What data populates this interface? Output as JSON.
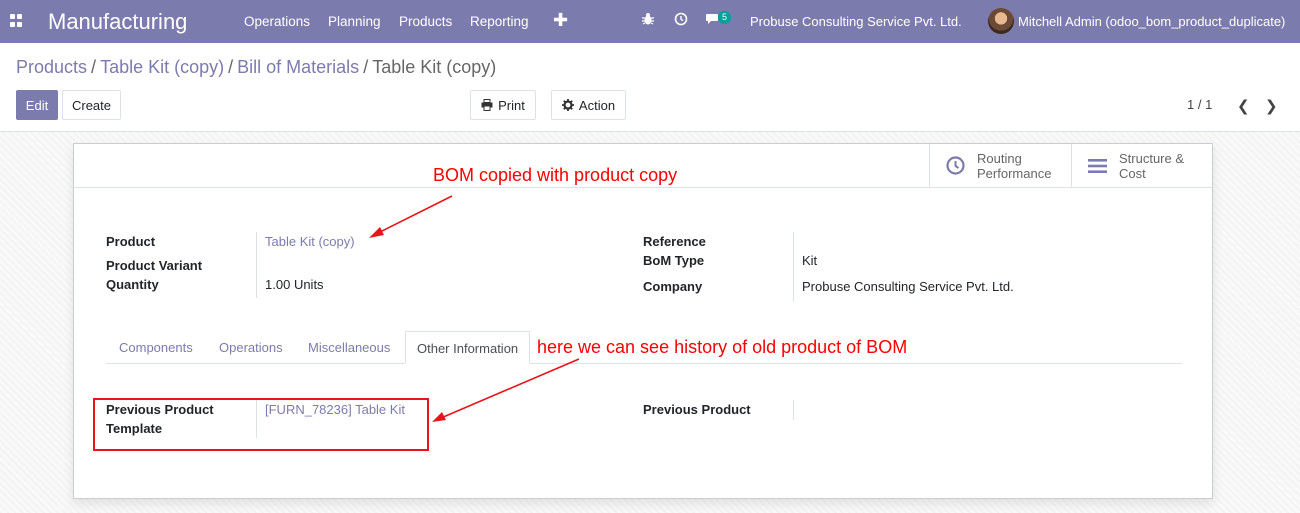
{
  "nav": {
    "brand": "Manufacturing",
    "menu": [
      "Operations",
      "Planning",
      "Products",
      "Reporting"
    ],
    "chat_count": "5",
    "company": "Probuse Consulting Service Pvt. Ltd.",
    "user": "Mitchell Admin (odoo_bom_product_duplicate)"
  },
  "breadcrumb": [
    "Products",
    "Table Kit (copy)",
    "Bill of Materials",
    "Table Kit (copy)"
  ],
  "buttons": {
    "edit": "Edit",
    "create": "Create",
    "print": "Print",
    "action": "Action"
  },
  "pager": "1 / 1",
  "smart_buttons": {
    "routing": [
      "Routing",
      "Performance"
    ],
    "structure": [
      "Structure &",
      "Cost"
    ]
  },
  "fields": {
    "product_label": "Product",
    "product_value": "Table Kit (copy)",
    "variant_label": "Product Variant",
    "quantity_label": "Quantity",
    "quantity_value": "1.00",
    "quantity_uom": "Units",
    "reference_label": "Reference",
    "bom_type_label": "BoM Type",
    "bom_type_value": "Kit",
    "company_label": "Company",
    "company_value": "Probuse Consulting Service Pvt. Ltd."
  },
  "tabs": [
    "Components",
    "Operations",
    "Miscellaneous",
    "Other Information"
  ],
  "other_info": {
    "prev_template_label_1": "Previous Product",
    "prev_template_label_2": "Template",
    "prev_template_value": "[FURN_78236] Table Kit",
    "prev_product_label": "Previous Product"
  },
  "annotations": {
    "bom_copied": "BOM copied with product copy",
    "history": "here we can see history of old product of BOM"
  },
  "colors": {
    "primary": "#7c7bad",
    "annotation": "#ff0000"
  }
}
